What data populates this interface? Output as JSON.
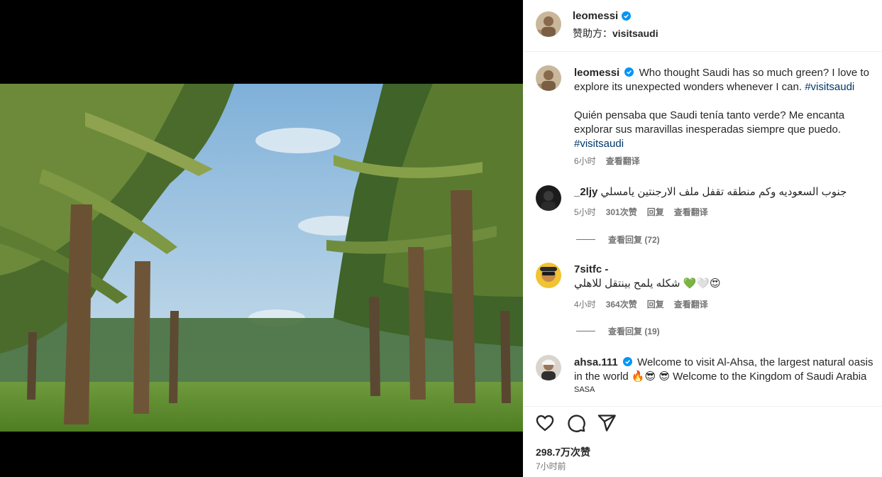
{
  "post": {
    "username": "leomessi",
    "sponsor_prefix": "赞助方：",
    "sponsor": "visitsaudi",
    "caption_en": "Who thought Saudi has so much green? I love to explore its unexpected wonders whenever I can. ",
    "caption_tag1": "#visitsaudi",
    "caption_es": "Quién pensaba que Saudi tenía tanto verde? Me encanta explorar sus maravillas inesperadas siempre que puedo. ",
    "caption_tag2": "#visitsaudi",
    "caption_time": "6小时",
    "caption_translate": "查看翻译"
  },
  "comments": [
    {
      "username": "_2ljy",
      "text": "جنوب السعوديه وكم منطقه تقفل ملف الارجنتين يامسلي",
      "time": "5小时",
      "likes": "301次赞",
      "reply": "回复",
      "translate": "查看翻译",
      "view_replies": "查看回复 (72)"
    },
    {
      "username": "7sitfc -",
      "text": "شكله يلمح بينتقل للاهلي",
      "emoji": "💚🤍😍",
      "time": "4小时",
      "likes": "364次赞",
      "reply": "回复",
      "translate": "查看翻译",
      "view_replies": "查看回复 (19)"
    },
    {
      "username": "ahsa.111",
      "text": "Welcome to visit Al-Ahsa, the largest natural oasis in the world 🔥😎 😎 Welcome to the Kingdom of Saudi Arabia",
      "subtext": "SASA"
    }
  ],
  "footer": {
    "likes": "298.7万次赞",
    "time": "7小时前"
  },
  "icons": {
    "like": "heart-icon",
    "comment": "comment-bubble-icon",
    "share": "send-icon",
    "verified": "verified-badge-icon"
  },
  "colors": {
    "text": "#262626",
    "secondary": "#737373",
    "link": "#00376b",
    "verified": "#0095f6"
  }
}
